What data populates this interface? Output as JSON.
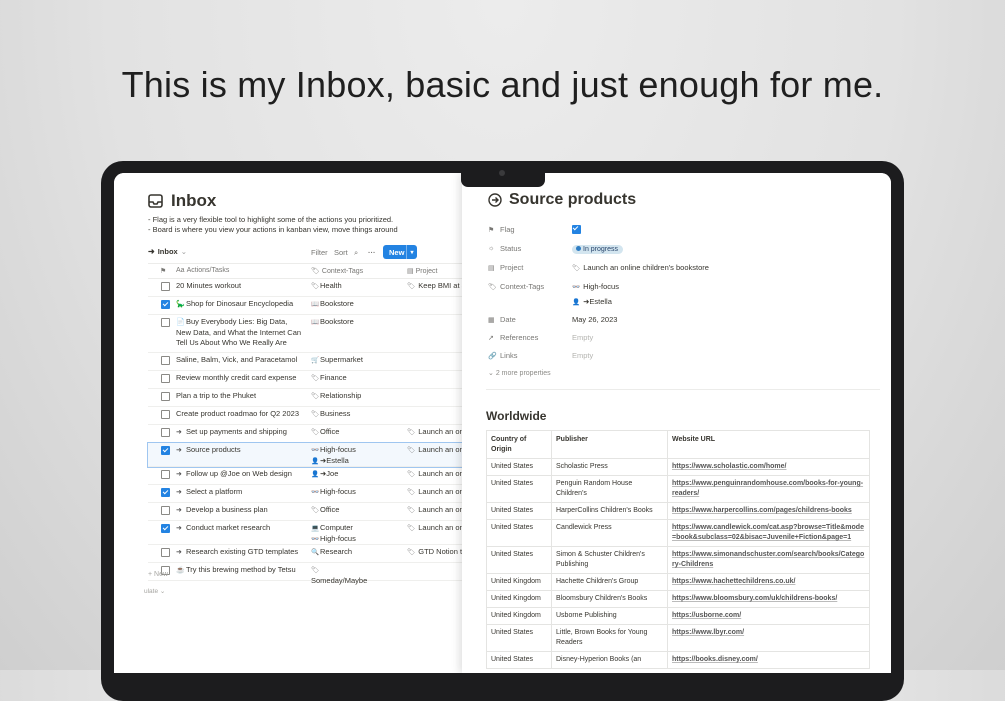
{
  "headline": "This is my Inbox, basic and just enough for me.",
  "left": {
    "title": "Inbox",
    "title_icon": "tray-icon",
    "description": [
      "- Flag is a very flexible tool to highlight some of the actions you prioritized.",
      "- Board is where you view your actions in kanban view, move things around"
    ],
    "view_name": "Inbox",
    "filter_label": "Filter",
    "sort_label": "Sort",
    "new_label": "New",
    "columns": {
      "task": "Actions/Tasks",
      "context": "Context-Tags",
      "project": "Project"
    },
    "rows": [
      {
        "checked": false,
        "icon": "",
        "task": "20 Minutes workout",
        "context": [
          {
            "icon": "🏷",
            "label": "Health"
          }
        ],
        "project": "Keep BMI at a",
        "height": 17
      },
      {
        "checked": true,
        "icon": "🦕",
        "task": "Shop for Dinosaur Encyclopedia",
        "context": [
          {
            "icon": "📖",
            "label": "Bookstore"
          }
        ],
        "project": "",
        "height": 17
      },
      {
        "checked": false,
        "icon": "📄",
        "task": "Buy Everybody Lies: Big Data, New Data, and What the Internet Can Tell Us About Who We Really Are",
        "context": [
          {
            "icon": "📖",
            "label": "Bookstore"
          }
        ],
        "project": "",
        "height": 37
      },
      {
        "checked": false,
        "icon": "",
        "task": "Saline, Balm, Vick, and Paracetamol",
        "context": [
          {
            "icon": "🛒",
            "label": "Supermarket"
          }
        ],
        "project": "",
        "height": 17
      },
      {
        "checked": false,
        "icon": "",
        "task": "Review monthly credit card expense",
        "context": [
          {
            "icon": "🏷",
            "label": "Finance"
          }
        ],
        "project": "",
        "height": 17
      },
      {
        "checked": false,
        "icon": "",
        "task": "Plan a trip to the Phuket",
        "context": [
          {
            "icon": "🏷",
            "label": "Relationship"
          }
        ],
        "project": "",
        "height": 17
      },
      {
        "checked": false,
        "icon": "",
        "task": "Create product roadmao for Q2 2023",
        "context": [
          {
            "icon": "🏷",
            "label": "Business"
          }
        ],
        "project": "",
        "height": 17
      },
      {
        "checked": false,
        "icon": "➜",
        "task": "Set up payments and shipping",
        "context": [
          {
            "icon": "🏷",
            "label": "Office"
          }
        ],
        "project": "Launch an onl",
        "height": 17
      },
      {
        "checked": true,
        "icon": "➜",
        "task": "Source products",
        "context": [
          {
            "icon": "👓",
            "label": "High-focus"
          },
          {
            "icon": "👤",
            "label": "➜Estella"
          }
        ],
        "project": "Launch an onl",
        "height": 23,
        "selected": true
      },
      {
        "checked": false,
        "icon": "➜",
        "task": "Follow up @Joe on Web design",
        "context": [
          {
            "icon": "👤",
            "label": "➜Joe"
          }
        ],
        "project": "Launch an onl",
        "height": 17
      },
      {
        "checked": true,
        "icon": "➜",
        "task": "Select a platform",
        "context": [
          {
            "icon": "👓",
            "label": "High-focus"
          }
        ],
        "project": "Launch an onl",
        "height": 17
      },
      {
        "checked": false,
        "icon": "➜",
        "task": "Develop a business plan",
        "context": [
          {
            "icon": "🏷",
            "label": "Office"
          }
        ],
        "project": "Launch an onl",
        "height": 17
      },
      {
        "checked": true,
        "icon": "➜",
        "task": "Conduct market research",
        "context": [
          {
            "icon": "💻",
            "label": "Computer"
          },
          {
            "icon": "👓",
            "label": "High-focus"
          }
        ],
        "project": "Launch an onl",
        "height": 23
      },
      {
        "checked": false,
        "icon": "➜",
        "task": "Research existing GTD templates",
        "context": [
          {
            "icon": "🔍",
            "label": "Research"
          }
        ],
        "project": "GTD Notion te",
        "height": 17
      },
      {
        "checked": false,
        "icon": "☕",
        "task": "Try this brewing method by Tetsu",
        "context": [
          {
            "icon": "🏷",
            "label": "Someday/Maybe"
          }
        ],
        "project": "",
        "height": 17
      }
    ],
    "add_new": "+ New",
    "calculate": "ulate ⌄"
  },
  "right": {
    "title": "Source products",
    "properties": [
      {
        "icon": "⚑",
        "label": "Flag",
        "type": "checkbox",
        "value": "checked"
      },
      {
        "icon": "☼",
        "label": "Status",
        "type": "pill",
        "value": "In progress"
      },
      {
        "icon": "▤",
        "label": "Project",
        "type": "text",
        "value": "Launch an online children's bookstore",
        "value_icon": "🏷"
      },
      {
        "icon": "🏷",
        "label": "Context-Tags",
        "type": "text",
        "value": "High-focus",
        "value_icon": "👓"
      },
      {
        "icon": "",
        "label": "",
        "type": "text",
        "value": "➜Estella",
        "value_icon": "👤"
      },
      {
        "icon": "▦",
        "label": "Date",
        "type": "text",
        "value": "May 26, 2023"
      },
      {
        "icon": "↗",
        "label": "References",
        "type": "empty",
        "value": "Empty"
      },
      {
        "icon": "🔗",
        "label": "Links",
        "type": "empty",
        "value": "Empty"
      }
    ],
    "more_props": "2 more properties",
    "section_title": "Worldwide",
    "table_headers": [
      "Country of Origin",
      "Publisher",
      "Website URL"
    ],
    "table_rows": [
      [
        "United States",
        "Scholastic Press",
        "https://www.scholastic.com/home/"
      ],
      [
        "United States",
        "Penguin Random House Children's",
        "https://www.penguinrandomhouse.com/books-for-young-readers/"
      ],
      [
        "United States",
        "HarperCollins Children's Books",
        "https://www.harpercollins.com/pages/childrens-books"
      ],
      [
        "United States",
        "Candlewick Press",
        "https://www.candlewick.com/cat.asp?browse=Title&mode=book&subclass=02&bisac=Juvenile+Fiction&page=1"
      ],
      [
        "United States",
        "Simon & Schuster Children's Publishing",
        "https://www.simonandschuster.com/search/books/Category-Childrens"
      ],
      [
        "United Kingdom",
        "Hachette Children's Group",
        "https://www.hachettechildrens.co.uk/"
      ],
      [
        "United Kingdom",
        "Bloomsbury Children's Books",
        "https://www.bloomsbury.com/uk/childrens-books/"
      ],
      [
        "United Kingdom",
        "Usborne Publishing",
        "https://usborne.com/"
      ],
      [
        "United States",
        "Little, Brown Books for Young Readers",
        "https://www.lbyr.com/"
      ],
      [
        "United States",
        "Disney-Hyperion Books (an",
        "https://books.disney.com/"
      ]
    ]
  },
  "colors": {
    "accent": "#2383e2",
    "pill_bg": "#d3e5ef",
    "text": "#37352f",
    "muted": "#787774"
  }
}
